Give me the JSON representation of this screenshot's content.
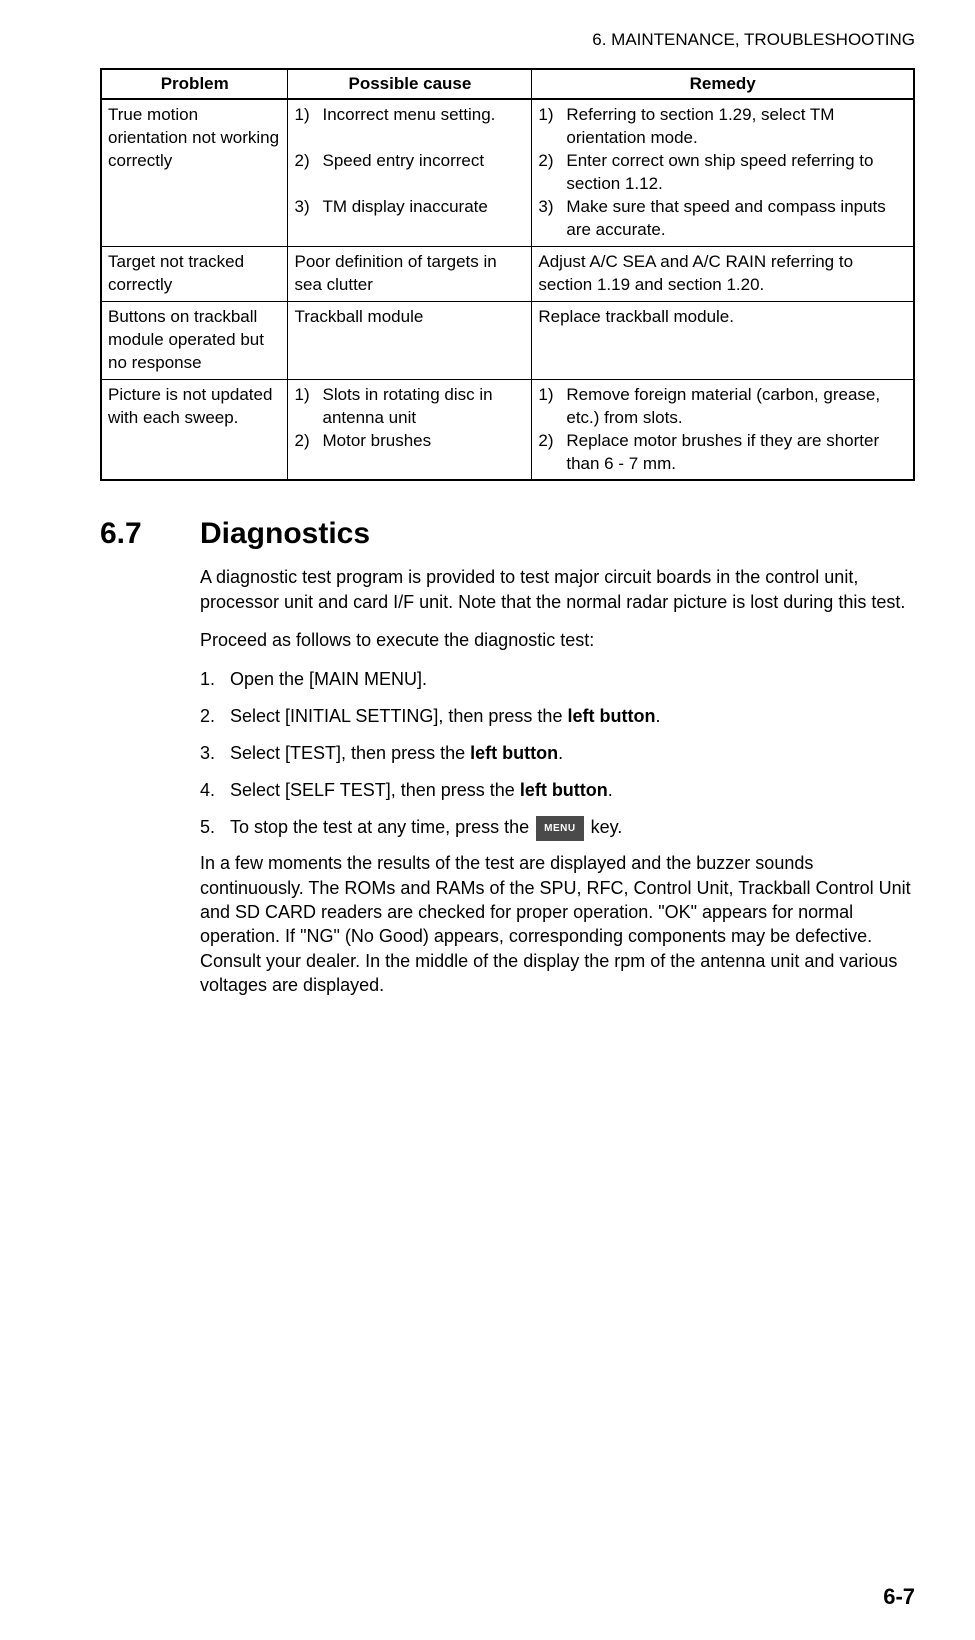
{
  "header": "6.  MAINTENANCE, TROUBLESHOOTING",
  "table": {
    "headers": [
      "Problem",
      "Possible cause",
      "Remedy"
    ],
    "rows": [
      {
        "problem": "True motion orientation not working correctly",
        "cause": {
          "type": "list",
          "items": [
            {
              "n": "1)",
              "t": "Incorrect menu setting."
            },
            {
              "n": "2)",
              "t": "Speed entry incorrect"
            },
            {
              "n": "3)",
              "t": "TM display inaccurate"
            }
          ]
        },
        "remedy": {
          "type": "list",
          "items": [
            {
              "n": "1)",
              "t": "Referring to section 1.29, select TM orientation mode."
            },
            {
              "n": "2)",
              "t": "Enter correct own ship speed referring to section 1.12."
            },
            {
              "n": "3)",
              "t": "Make sure that speed and compass inputs are accurate."
            }
          ]
        }
      },
      {
        "problem": "Target not tracked correctly",
        "cause": {
          "type": "text",
          "text": "Poor definition of targets in sea clutter"
        },
        "remedy": {
          "type": "text",
          "text": "Adjust A/C SEA and A/C RAIN referring to section 1.19 and section 1.20."
        }
      },
      {
        "problem": "Buttons on trackball module operated but no response",
        "cause": {
          "type": "text",
          "text": "Trackball module"
        },
        "remedy": {
          "type": "text",
          "text": "Replace trackball module."
        }
      },
      {
        "problem": "Picture is not updated with each sweep.",
        "cause": {
          "type": "list",
          "items": [
            {
              "n": "1)",
              "t": "Slots in rotating disc in antenna unit"
            },
            {
              "n": "2)",
              "t": "Motor brushes"
            }
          ]
        },
        "remedy": {
          "type": "list",
          "items": [
            {
              "n": "1)",
              "t": "Remove foreign material (carbon, grease, etc.) from slots."
            },
            {
              "n": "2)",
              "t": "Replace motor brushes if they are shorter than 6 - 7 mm."
            }
          ]
        }
      }
    ]
  },
  "section": {
    "number": "6.7",
    "title": "Diagnostics",
    "intro": "A diagnostic test program is provided to test major circuit boards in the control unit, processor unit and card I/F unit. Note that the normal radar picture is lost during this test.",
    "proceed": "Proceed as follows to execute the diagnostic test:",
    "steps": [
      {
        "n": "1.",
        "parts": [
          {
            "t": "Open the [MAIN MENU]."
          }
        ]
      },
      {
        "n": "2.",
        "parts": [
          {
            "t": "Select [INITIAL SETTING], then press the "
          },
          {
            "t": "left button",
            "bold": true
          },
          {
            "t": "."
          }
        ]
      },
      {
        "n": "3.",
        "parts": [
          {
            "t": "Select [TEST], then press the "
          },
          {
            "t": "left button",
            "bold": true
          },
          {
            "t": "."
          }
        ]
      },
      {
        "n": "4.",
        "parts": [
          {
            "t": "Select [SELF TEST], then press the "
          },
          {
            "t": "left button",
            "bold": true
          },
          {
            "t": "."
          }
        ]
      },
      {
        "n": "5.",
        "parts": [
          {
            "t": "To stop the test at any time, press the "
          },
          {
            "key": "MENU"
          },
          {
            "t": " key."
          }
        ]
      }
    ],
    "outro": "In a few moments the results of the test are displayed and the buzzer sounds continuously. The ROMs and RAMs of the SPU, RFC, Control Unit, Trackball Control Unit and SD CARD readers are checked for proper operation. \"OK\" appears for normal operation. If \"NG\" (No Good) appears, corresponding components may be defective. Consult your dealer. In the middle of the display the rpm of the antenna unit and various voltages are displayed."
  },
  "page_number": "6-7"
}
